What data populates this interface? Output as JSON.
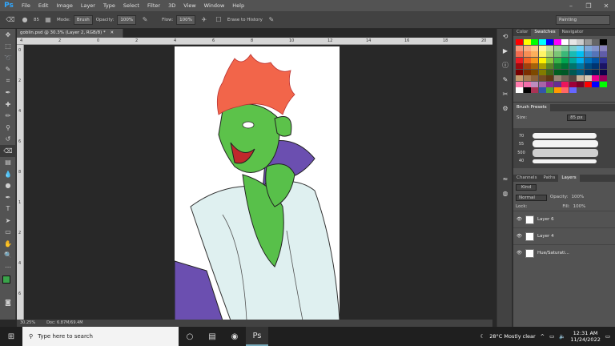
{
  "app": {
    "logo": "Ps"
  },
  "menu": [
    "File",
    "Edit",
    "Image",
    "Layer",
    "Type",
    "Select",
    "Filter",
    "3D",
    "View",
    "Window",
    "Help"
  ],
  "options": {
    "mode_label": "Mode:",
    "mode_value": "Brush",
    "opacity_label": "Opacity:",
    "opacity_value": "100%",
    "flow_label": "Flow:",
    "flow_value": "100%",
    "erase_history_label": "Erase to History",
    "brush_size": "85"
  },
  "workspace": "Painting",
  "document": {
    "tab_title": "goblin.psd @ 30.3% (Layer 2, RGB/8) *",
    "zoom": "30.25%",
    "doc_info": "Doc: 6.87M/69.4M"
  },
  "ruler": {
    "top_labels": [
      "4",
      "2",
      "0",
      "2",
      "4",
      "6",
      "8",
      "10",
      "12",
      "14",
      "16",
      "18",
      "20"
    ],
    "left_labels": [
      "0",
      "2",
      "4",
      "6",
      "8",
      "1",
      "2",
      "4",
      "6"
    ]
  },
  "panels": {
    "swatches_tabs": [
      "Color",
      "Swatches",
      "Navigator"
    ],
    "swatch_colors": [
      "#ff0000",
      "#ffff00",
      "#00ff00",
      "#00ffff",
      "#0000ff",
      "#ff00ff",
      "#ffffff",
      "#e5e5e5",
      "#cccccc",
      "#999999",
      "#666666",
      "#000000",
      "#f7977a",
      "#f9ad81",
      "#fdc68a",
      "#fff79a",
      "#c4df9b",
      "#a2d39c",
      "#82ca9d",
      "#7bcdc8",
      "#6ecff6",
      "#7ea7d8",
      "#8493ca",
      "#8882be",
      "#f26c4f",
      "#f68e55",
      "#fbaf5c",
      "#fff467",
      "#acd372",
      "#7cc576",
      "#3bb878",
      "#1abbb4",
      "#00bff3",
      "#438ccb",
      "#5574b9",
      "#605ca8",
      "#ed1c24",
      "#f26522",
      "#f7941d",
      "#fff200",
      "#8dc73f",
      "#39b54a",
      "#00a651",
      "#00a99d",
      "#00aeef",
      "#0072bc",
      "#0054a6",
      "#2e3192",
      "#9e0b0f",
      "#a0410d",
      "#a3620a",
      "#aba000",
      "#598527",
      "#197b30",
      "#007236",
      "#00746b",
      "#0076a3",
      "#004b80",
      "#003471",
      "#1b1464",
      "#790000",
      "#7b2e00",
      "#7d4900",
      "#827b00",
      "#406618",
      "#005e20",
      "#005826",
      "#005952",
      "#005b7f",
      "#003663",
      "#002157",
      "#0d004c",
      "#c69c6d",
      "#a67c52",
      "#8c6239",
      "#754c24",
      "#603913",
      "#998675",
      "#736357",
      "#534741",
      "#c7b299",
      "#d7cab5",
      "#ec008c",
      "#9e005d",
      "#ff7bac",
      "#f06eaa",
      "#bd8cbf",
      "#a864a8",
      "#92278f",
      "#662d91",
      "#ed145b",
      "#9e0039",
      "#7a0026",
      "#ff0000",
      "#0000ff",
      "#00ff00",
      "#ffffff",
      "#000000",
      "#aa3355",
      "#3355aa",
      "#55aa33",
      "#ff9900",
      "#ff6666",
      "#6666ff"
    ],
    "brush_tabs": [
      "Brush Presets"
    ],
    "size_label": "Size:",
    "size_value": "85 px",
    "brush_sizes": [
      "70",
      "55",
      "500",
      "40"
    ],
    "layer_tabs": [
      "Channels",
      "Paths",
      "Layers"
    ],
    "kind_label": "Kind",
    "blend_mode": "Normal",
    "opacity_label": "Opacity:",
    "opacity_value": "100%",
    "lock_label": "Lock:",
    "fill_label": "Fill:",
    "fill_value": "100%",
    "layers": [
      "Layer 6",
      "Layer 4",
      "Hue/Saturati..."
    ]
  },
  "taskbar": {
    "search_placeholder": "Type here to search",
    "weather": "28°C  Mostly clear",
    "time": "12:31 AM",
    "date": "11/24/2022"
  },
  "colors": {
    "foreground": "#3aa34a",
    "background": "#f0a8a0"
  }
}
